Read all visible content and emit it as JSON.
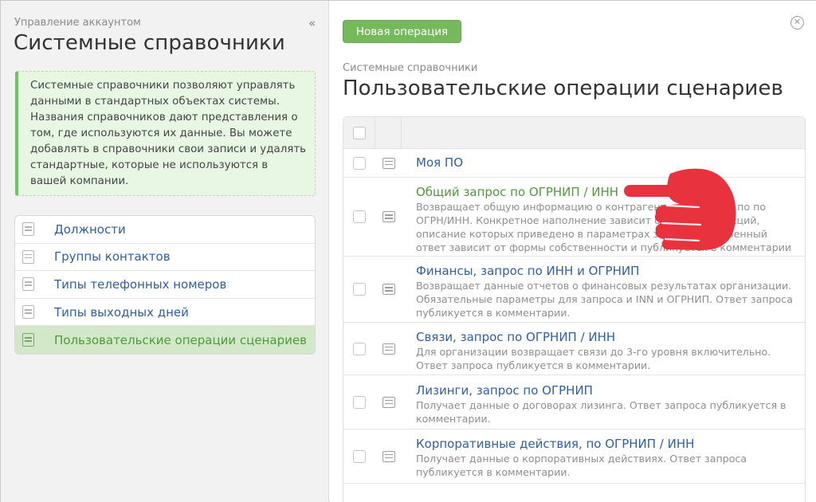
{
  "left": {
    "super_title": "Управление аккаунтом",
    "title": "Системные справочники",
    "collapse_icon": "«",
    "info_text": "Системные справочники позволяют управлять данными в стандартных объектах системы. Названия справочников дают представления о том, где используются их данные. Вы можете добавлять в справочники свои записи и удалять стандартные, которые не используются в вашей компании.",
    "items": [
      {
        "label": "Должности",
        "icon": "document-icon"
      },
      {
        "label": "Группы контактов",
        "icon": "document-icon"
      },
      {
        "label": "Типы телефонных номеров",
        "icon": "document-icon"
      },
      {
        "label": "Типы выходных дней",
        "icon": "document-icon"
      },
      {
        "label": "Пользовательские операции сценариев",
        "icon": "document-icon",
        "active": true
      }
    ]
  },
  "right": {
    "new_button": "Новая операция",
    "close_icon": "✕",
    "super_title": "Системные справочники",
    "title": "Пользовательские операции сценариев",
    "operations": [
      {
        "title": "Моя ПО",
        "desc": ""
      },
      {
        "title": "Общий запрос по ОГРНИП / ИНН",
        "desc": "Возвращает общую информацию о контрагенте по ОГРНИП по по ОГРН/ИНН. Конкретное наполнение зависит от формы и секций, описание которых приведено в параметрах запроса. Полученный ответ зависит от формы собственности и публикуется в комментарии"
      },
      {
        "title": "Финансы, запрос по ИНН и ОГРНИП",
        "desc": "Возвращает данные отчетов о финансовых результатах организации. Обязательные параметры для запроса и INN и ОГРНИП. Ответ запроса публикуется в комментарии."
      },
      {
        "title": "Связи, запрос по ОГРНИП / ИНН",
        "desc": "Для организации возвращает связи до 3-го уровня включительно. Ответ запроса публикуется в комментарии."
      },
      {
        "title": "Лизинги, запрос по ОГРНИП",
        "desc": "Получает данные о договорах лизинга. Ответ запроса публикуется в комментарии."
      },
      {
        "title": "Корпоративные действия, по ОГРНИП / ИНН",
        "desc": "Получает данные о корпоративных действиях. Ответ запроса публикуется в комментарии."
      }
    ]
  },
  "colors": {
    "accent_green": "#76b95c",
    "link_blue": "#2e5fa3",
    "pointer_red": "#e8333f"
  }
}
